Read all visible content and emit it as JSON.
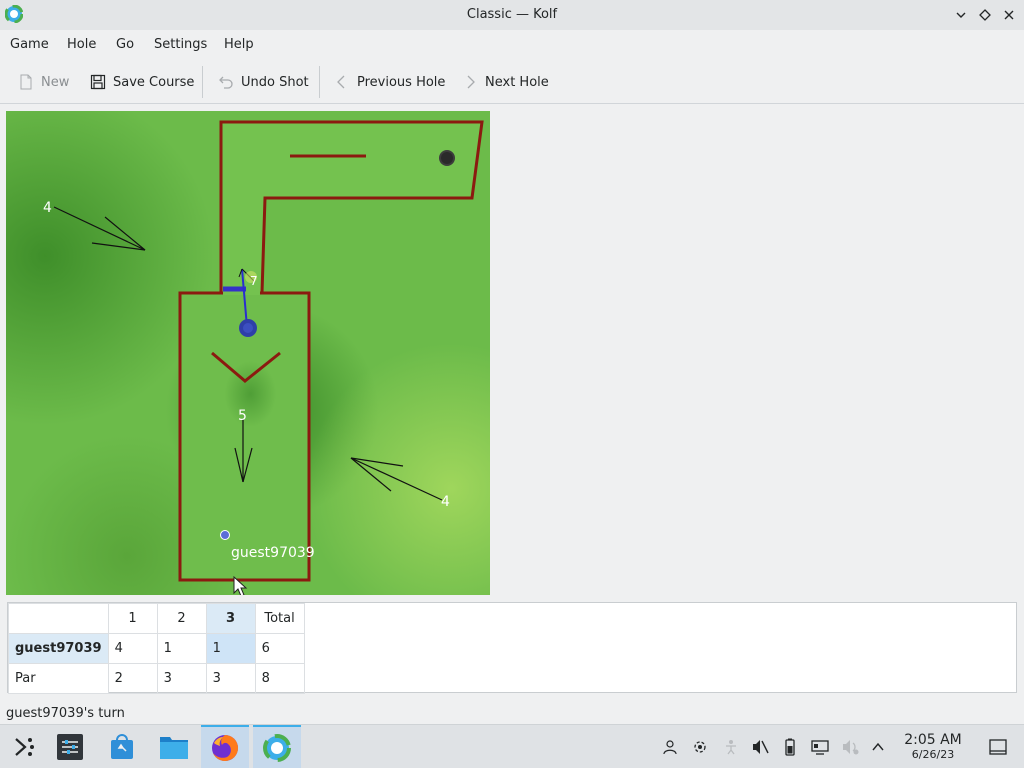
{
  "window": {
    "title": "Classic — Kolf"
  },
  "menu": {
    "items": [
      "Game",
      "Hole",
      "Go",
      "Settings",
      "Help"
    ]
  },
  "toolbar": {
    "new_label": "New",
    "save_label": "Save Course",
    "undo_label": "Undo Shot",
    "prev_label": "Previous Hole",
    "next_label": "Next Hole"
  },
  "course": {
    "labels": {
      "slope_top_left": "4",
      "slope_middle": "5",
      "slope_bottom_right": "4",
      "putter_strength": "7",
      "player_name": "guest97039"
    },
    "colors": {
      "grass": "#6cbb4a",
      "wall": "#8b1a10",
      "ball": "#2e3fa8"
    }
  },
  "scoreboard": {
    "columns": [
      "",
      "1",
      "2",
      "3",
      "Total"
    ],
    "current_hole_index": 3,
    "rows": [
      {
        "label": "guest97039",
        "cells": [
          "4",
          "1",
          "1",
          "6"
        ]
      },
      {
        "label": "Par",
        "cells": [
          "2",
          "3",
          "3",
          "8"
        ]
      }
    ]
  },
  "status": {
    "text": "guest97039's turn"
  },
  "taskbar": {
    "apps": [
      "application-launcher-icon",
      "system-settings-icon",
      "discover-store-icon",
      "file-manager-icon",
      "firefox-icon",
      "kolf-icon"
    ],
    "tray": [
      "user-icon",
      "network-icon",
      "accessibility-icon",
      "audio-muted-icon",
      "battery-icon",
      "display-icon",
      "volume-icon",
      "expand-tray-icon"
    ],
    "time": "2:05 AM",
    "date": "6/26/23"
  }
}
